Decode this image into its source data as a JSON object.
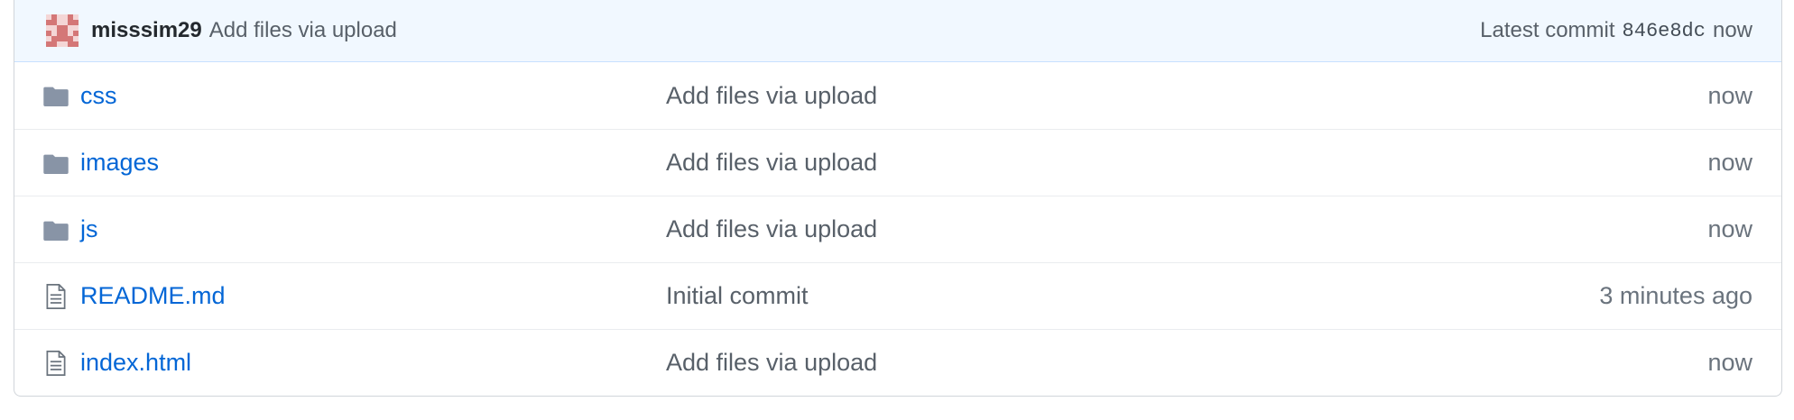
{
  "commit": {
    "author": "misssim29",
    "message": "Add files via upload",
    "latest_label": "Latest commit",
    "sha": "846e8dc",
    "time": "now"
  },
  "files": [
    {
      "name": "css",
      "type": "folder",
      "icon": "folder-icon",
      "message": "Add files via upload",
      "age": "now"
    },
    {
      "name": "images",
      "type": "folder",
      "icon": "folder-icon",
      "message": "Add files via upload",
      "age": "now"
    },
    {
      "name": "js",
      "type": "folder",
      "icon": "folder-icon",
      "message": "Add files via upload",
      "age": "now"
    },
    {
      "name": "README.md",
      "type": "file",
      "icon": "file-icon",
      "message": "Initial commit",
      "age": "3 minutes ago"
    },
    {
      "name": "index.html",
      "type": "file",
      "icon": "file-icon",
      "message": "Add files via upload",
      "age": "now"
    }
  ],
  "colors": {
    "link": "#0366d6",
    "header_bg": "#f1f8ff",
    "folder_icon": "#79b8ff",
    "file_icon": "#6a737d"
  }
}
